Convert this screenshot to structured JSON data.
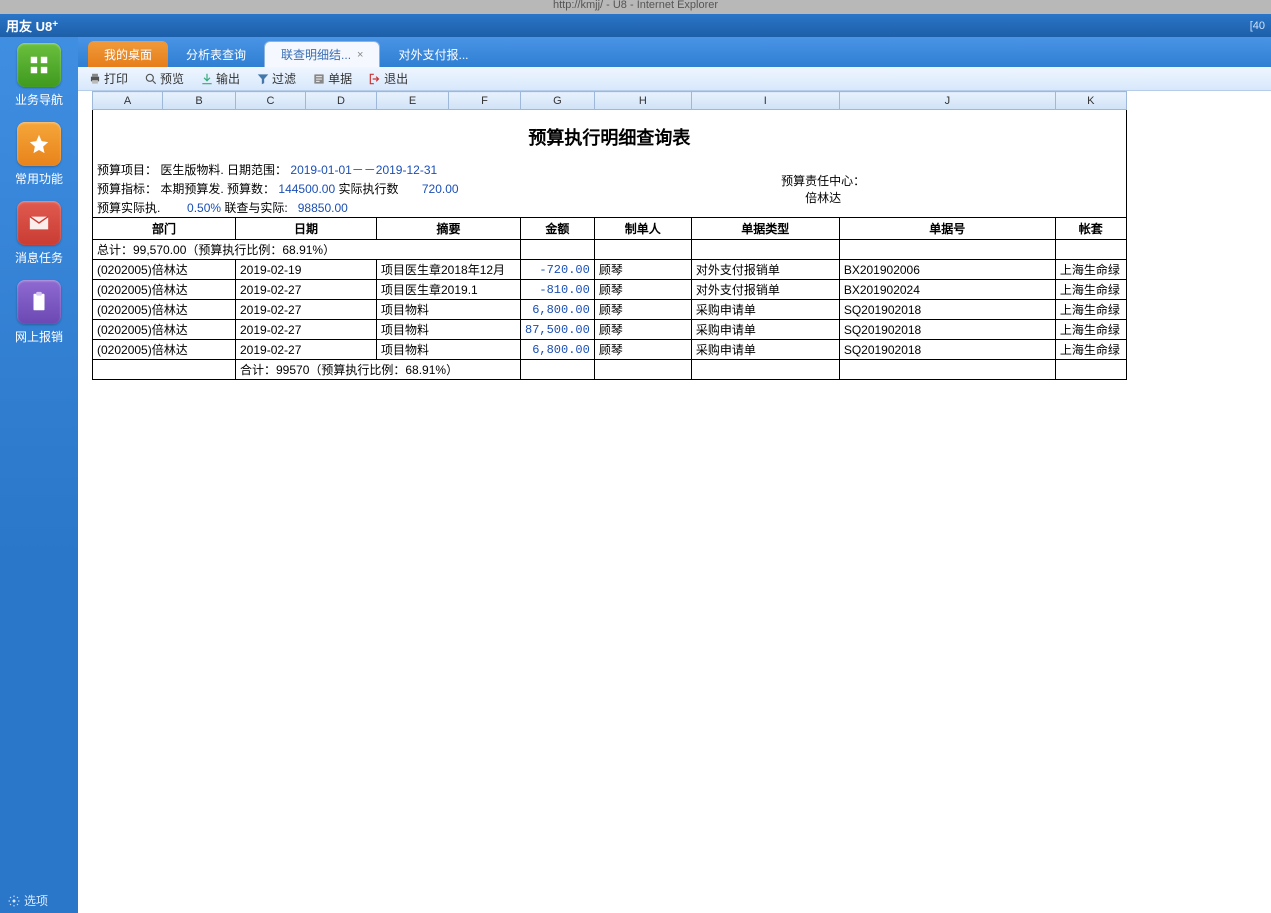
{
  "browser": {
    "title_fragment": "http://kmjj/ - U8 - Internet Explorer"
  },
  "header": {
    "logo_text": "用友 U8",
    "logo_plus": "+",
    "right_indicator": "[40"
  },
  "sidebar": {
    "items": [
      {
        "label": "业务导航"
      },
      {
        "label": "常用功能"
      },
      {
        "label": "消息任务"
      },
      {
        "label": "网上报销"
      }
    ],
    "footer": "选项"
  },
  "tabs": [
    {
      "label": "我的桌面"
    },
    {
      "label": "分析表查询"
    },
    {
      "label": "联查明细结..."
    },
    {
      "label": "对外支付报..."
    }
  ],
  "toolbar": {
    "print": "打印",
    "preview": "预览",
    "export": "输出",
    "filter": "过滤",
    "voucher": "单据",
    "exit": "退出"
  },
  "columns": [
    "A",
    "B",
    "C",
    "D",
    "E",
    "F",
    "G",
    "H",
    "I",
    "J",
    "K"
  ],
  "report": {
    "title": "预算执行明细查询表",
    "meta": {
      "l1a": "预算项目：",
      "l1a_v": "医生版物料.",
      "l1b": "日期范围：",
      "l1b_v": "2019-01-01－－2019-12-31",
      "l2a": "预算指标：",
      "l2a_v": "本期预算发.",
      "l2b": "预算数：",
      "l2b_v": "144500.00",
      "l2c": "实际执行数",
      "l2c_v": "720.00",
      "l3a": "预算实际执.",
      "l3a_v": "0.50%",
      "l3b": "联查与实际:",
      "l3b_v": "98850.00",
      "r1": "预算责任中心：",
      "r2": "倍林达"
    },
    "headers": {
      "dept": "部门",
      "date": "日期",
      "summary": "摘要",
      "amount": "金额",
      "maker": "制单人",
      "doctype": "单据类型",
      "docno": "单据号",
      "book": "帐套"
    },
    "grand_total": "总计：99,570.00（预算执行比例：68.91%）",
    "rows": [
      {
        "dept": "(0202005)倍林达",
        "date": "2019-02-19",
        "summary": "项目医生章2018年12月",
        "amount": "-720.00",
        "maker": "顾琴",
        "doctype": "对外支付报销单",
        "docno": "BX201902006",
        "book": "上海生命绿"
      },
      {
        "dept": "(0202005)倍林达",
        "date": "2019-02-27",
        "summary": "项目医生章2019.1",
        "amount": "-810.00",
        "maker": "顾琴",
        "doctype": "对外支付报销单",
        "docno": "BX201902024",
        "book": "上海生命绿"
      },
      {
        "dept": "(0202005)倍林达",
        "date": "2019-02-27",
        "summary": "项目物料",
        "amount": "6,800.00",
        "maker": "顾琴",
        "doctype": "采购申请单",
        "docno": "SQ201902018",
        "book": "上海生命绿"
      },
      {
        "dept": "(0202005)倍林达",
        "date": "2019-02-27",
        "summary": "项目物料",
        "amount": "87,500.00",
        "maker": "顾琴",
        "doctype": "采购申请单",
        "docno": "SQ201902018",
        "book": "上海生命绿"
      },
      {
        "dept": "(0202005)倍林达",
        "date": "2019-02-27",
        "summary": "项目物料",
        "amount": "6,800.00",
        "maker": "顾琴",
        "doctype": "采购申请单",
        "docno": "SQ201902018",
        "book": "上海生命绿"
      }
    ],
    "subtotal": "合计：99570（预算执行比例：68.91%）"
  }
}
